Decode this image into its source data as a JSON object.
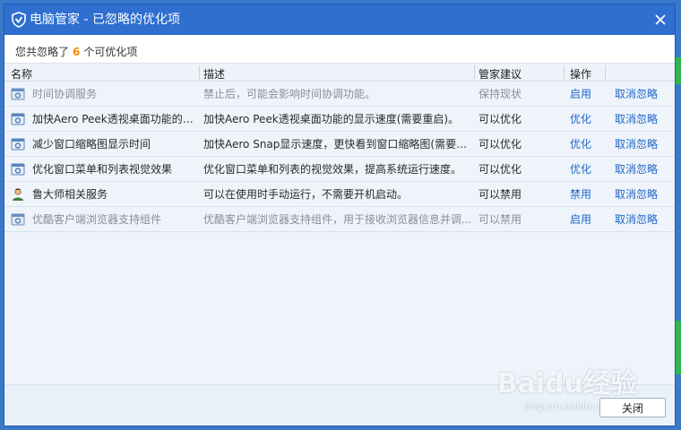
{
  "window": {
    "title": "电脑管家 - 已忽略的优化项"
  },
  "summary": {
    "prefix": "您共忽略了",
    "count": "6",
    "suffix": "个可优化项"
  },
  "table": {
    "headers": [
      "名称",
      "描述",
      "管家建议",
      "操作"
    ],
    "rows": [
      {
        "name": "时间协调服务",
        "desc": "禁止后，可能会影响时间协调功能。",
        "advice": "保持现状",
        "action": "启用",
        "unignore": "取消忽略",
        "icon": "service-icon",
        "dim": true
      },
      {
        "name": "加快Aero Peek透视桌面功能的显...",
        "desc": "加快Aero Peek透视桌面功能的显示速度(需要重启)。",
        "advice": "可以优化",
        "action": "优化",
        "unignore": "取消忽略",
        "icon": "window-icon",
        "dim": false
      },
      {
        "name": "减少窗口缩略图显示时间",
        "desc": "加快Aero Snap显示速度，更快看到窗口缩略图(需要重...",
        "advice": "可以优化",
        "action": "优化",
        "unignore": "取消忽略",
        "icon": "window-icon",
        "dim": false
      },
      {
        "name": "优化窗口菜单和列表视觉效果",
        "desc": "优化窗口菜单和列表的视觉效果，提高系统运行速度。",
        "advice": "可以优化",
        "action": "优化",
        "unignore": "取消忽略",
        "icon": "window-icon",
        "dim": false
      },
      {
        "name": "鲁大师相关服务",
        "desc": "可以在使用时手动运行，不需要开机启动。",
        "advice": "可以禁用",
        "action": "禁用",
        "unignore": "取消忽略",
        "icon": "user-icon",
        "dim": false
      },
      {
        "name": "优酷客户端浏览器支持组件",
        "desc": "优酷客户端浏览器支持组件，用于接收浏览器信息并调...",
        "advice": "可以禁用",
        "action": "启用",
        "unignore": "取消忽略",
        "icon": "service-icon",
        "dim": true
      }
    ]
  },
  "footer": {
    "close_label": "关闭"
  },
  "watermark": {
    "main": "Baidu经验",
    "sub": "jingyan.baidu.com"
  },
  "colors": {
    "titlebar": "#2f6fd0",
    "link": "#1f66c9",
    "count": "#f28c00"
  }
}
